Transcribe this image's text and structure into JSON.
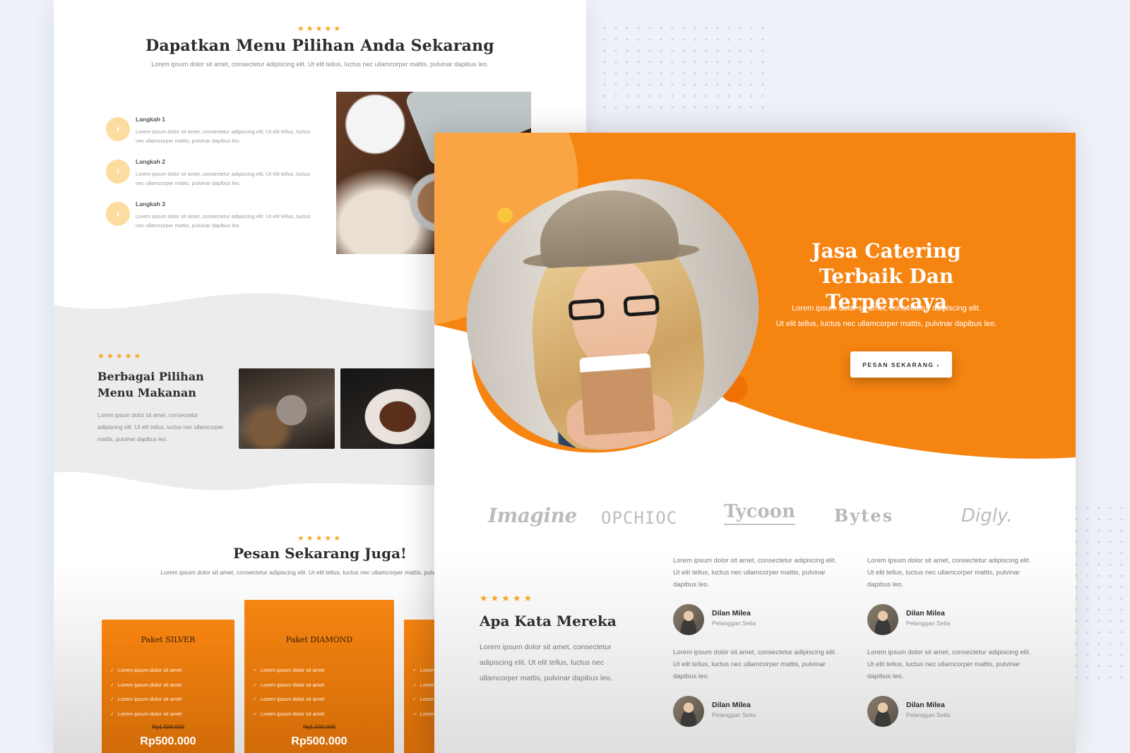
{
  "back_page": {
    "section1": {
      "stars": "★★★★★",
      "title": "Dapatkan Menu Pilihan Anda Sekarang",
      "subtitle": "Lorem ipsum dolor sit amet, consectetur adipiscing elit. Ut elit tellus, luctus nec ullamcorper mattis, pulvinar dapibus leo.",
      "steps": [
        {
          "label": "Langkah 1",
          "text": "Lorem ipsum dolor sit amet, consectetur adipiscing elit. Ut elit tellus, luctus nec ullamcorper mattis, pulvinar dapibus leo."
        },
        {
          "label": "Langkah 2",
          "text": "Lorem ipsum dolor sit amet, consectetur adipiscing elit. Ut elit tellus, luctus nec ullamcorper mattis, pulvinar dapibus leo."
        },
        {
          "label": "Langkah 3",
          "text": "Lorem ipsum dolor sit amet, consectetur adipiscing elit. Ut elit tellus, luctus nec ullamcorper mattis, pulvinar dapibus leo."
        }
      ]
    },
    "section2": {
      "stars": "★★★★★",
      "title": "Berbagai Pilihan Menu Makanan",
      "text": "Lorem ipsum dolor sit amet, consectetur adipiscing elit. Ut elit tellus, luctus nec ullamcorper mattis, pulvinar dapibus leo."
    },
    "section3": {
      "stars": "★★★★★",
      "title": "Pesan Sekarang Juga!",
      "subtitle": "Lorem ipsum dolor sit amet, consectetur adipiscing elit. Ut elit tellus, luctus nec ullamcorper mattis, pulvinar dapibus leo.",
      "packages": [
        {
          "name": "Paket SILVER",
          "features": [
            "Lorem ipsum dolor sit amet",
            "Lorem ipsum dolor sit amet",
            "Lorem ipsum dolor sit amet",
            "Lorem ipsum dolor sit amet"
          ],
          "old_price": "Rp1.500.000",
          "price": "Rp500.000"
        },
        {
          "name": "Paket DIAMOND",
          "features": [
            "Lorem ipsum dolor sit amet",
            "Lorem ipsum dolor sit amet",
            "Lorem ipsum dolor sit amet",
            "Lorem ipsum dolor sit amet"
          ],
          "old_price": "Rp1.500.000",
          "price": "Rp500.000"
        },
        {
          "name": "",
          "features": [
            "Lorem",
            "Lorem",
            "Lorem",
            "Lorem"
          ],
          "old_price": "",
          "price": ""
        }
      ]
    }
  },
  "front_page": {
    "hero": {
      "title_line1": "Jasa Catering",
      "title_line2": "Terbaik Dan Terpercaya",
      "subtitle_line1": "Lorem ipsum dolor sit amet, consectetur adipiscing elit.",
      "subtitle_line2": "Ut elit tellus, luctus nec ullamcorper mattis, pulvinar dapibus leo.",
      "button_label": "PESAN SEKARANG ›"
    },
    "logos": [
      "Imagine",
      "OPCHIOC",
      "Tycoon",
      "Bytes",
      "Digly."
    ],
    "testimonials": {
      "stars": "★★★★★",
      "title": "Apa Kata Mereka",
      "text": "Lorem ipsum dolor sit amet, consectetur adipiscing elit. Ut elit tellus, luctus nec ullamcorper mattis, pulvinar dapibus leo.",
      "items": [
        {
          "quote": "Lorem ipsum dolor sit amet, consectetur adipiscing elit. Ut elit tellus, luctus nec ullamcorper mattis, pulvinar dapibus leo.",
          "name": "Dilan Milea",
          "role": "Pelanggan Setia"
        },
        {
          "quote": "Lorem ipsum dolor sit amet, consectetur adipiscing elit. Ut elit tellus, luctus nec ullamcorper mattis, pulvinar dapibus leo.",
          "name": "Dilan Milea",
          "role": "Pelanggan Setia"
        },
        {
          "quote": "Lorem ipsum dolor sit amet, consectetur adipiscing elit. Ut elit tellus, luctus nec ullamcorper mattis, pulvinar dapibus leo.",
          "name": "Dilan Milea",
          "role": "Pelanggan Setia"
        },
        {
          "quote": "Lorem ipsum dolor sit amet, consectetur adipiscing elit. Ut elit tellus, luctus nec ullamcorper mattis, pulvinar dapibus leo.",
          "name": "Dilan Milea",
          "role": "Pelanggan Setia"
        }
      ]
    }
  },
  "colors": {
    "accent_orange": "#f68411",
    "accent_light_orange": "#fba94a",
    "star_gold": "#f6a623",
    "step_circle": "#fddca0",
    "background": "#eef1f7"
  },
  "icons": {
    "step_arrow": "chevron-right-icon",
    "star": "star-icon",
    "check": "check-icon"
  }
}
